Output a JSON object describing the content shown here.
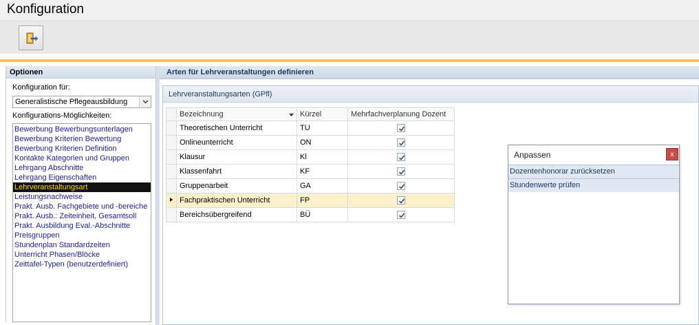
{
  "window": {
    "title": "Konfiguration"
  },
  "toolbar": {
    "exit_icon": "exit-door-icon"
  },
  "left": {
    "header": "Optionen",
    "config_for_label": "Konfiguration für:",
    "config_for_value": "Generalistische Pflegeausbildung",
    "options_label": "Konfigurations-Möglichkeiten:",
    "items": [
      "Bewerbung Bewerbungsunterlagen",
      "Bewerbung Kriterien Bewertung",
      "Bewerbung Kriterien Definition",
      "Kontakte Kategorien und Gruppen",
      "Lehrgang Abschnitte",
      "Lehrgang Eigenschaften",
      "Lehrveranstaltungsart",
      "Leistungsnachweise",
      "Prakt. Ausb. Fachgebiete und -bereiche",
      "Prakt. Ausb.: Zeiteinheit, Gesamtsoll",
      "Prakt. Ausbildung Eval.-Abschnitte",
      "Preisgruppen",
      "Stundenplan Standardzeiten",
      "Unterricht Phasen/Blöcke",
      "Zeittafel-Typen (benutzerdefiniert)"
    ],
    "selected_item": "Lehrveranstaltungsart"
  },
  "main": {
    "header": "Arten für Lehrveranstaltungen definieren",
    "group_title": "Lehrveranstaltungsarten (GPfl)",
    "columns": [
      "Bezeichnung",
      "Kürzel",
      "Mehrfachverplanung Dozent"
    ],
    "rows": [
      {
        "name": "Theoretischen Unterricht",
        "code": "TU",
        "multi": true
      },
      {
        "name": "Onlineunterricht",
        "code": "ON",
        "multi": true
      },
      {
        "name": "Klausur",
        "code": "Kl",
        "multi": true
      },
      {
        "name": "Klassenfahrt",
        "code": "KF",
        "multi": true
      },
      {
        "name": "Gruppenarbeit",
        "code": "GA",
        "multi": true
      },
      {
        "name": "Fachpraktischen Unterricht",
        "code": "FP",
        "multi": true
      },
      {
        "name": "Bereichsübergreifend",
        "code": "BÜ",
        "multi": true
      }
    ],
    "current_row": 5
  },
  "popup": {
    "title": "Anpassen",
    "close": "x",
    "items": [
      "Dozentenhonorar zurücksetzen",
      "Stundenwerte prüfen"
    ]
  },
  "colors": {
    "accent_orange": "#f6c25c",
    "selection_bg": "#111111",
    "selection_fg": "#ffd800",
    "current_row": "#fdf1cc"
  }
}
